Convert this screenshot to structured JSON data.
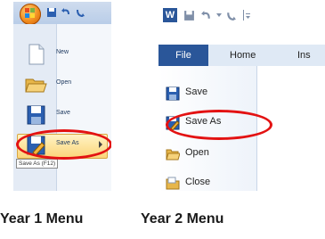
{
  "panels": {
    "year1": {
      "menu_items": [
        {
          "label": "New",
          "icon": "new-document-icon"
        },
        {
          "label": "Open",
          "icon": "open-folder-icon"
        },
        {
          "label": "Save",
          "icon": "save-icon"
        },
        {
          "label": "Save As",
          "icon": "save-as-icon",
          "highlighted": true
        }
      ],
      "tooltip": "Save As (F12)"
    },
    "year2": {
      "ribbon_tabs": [
        "File",
        "Home",
        "Ins"
      ],
      "backstage_items": [
        {
          "label": "Save",
          "icon": "save-icon"
        },
        {
          "label": "Save As",
          "icon": "save-as-icon",
          "highlighted": true
        },
        {
          "label": "Open",
          "icon": "open-folder-icon"
        },
        {
          "label": "Close",
          "icon": "close-folder-icon"
        }
      ]
    }
  },
  "captions": {
    "year1": "Year 1 Menu",
    "year2": "Year 2 Menu"
  },
  "colors": {
    "highlight_oval": "#e31212",
    "file_tab": "#2a5699",
    "office_orb": "#f08a1c"
  }
}
